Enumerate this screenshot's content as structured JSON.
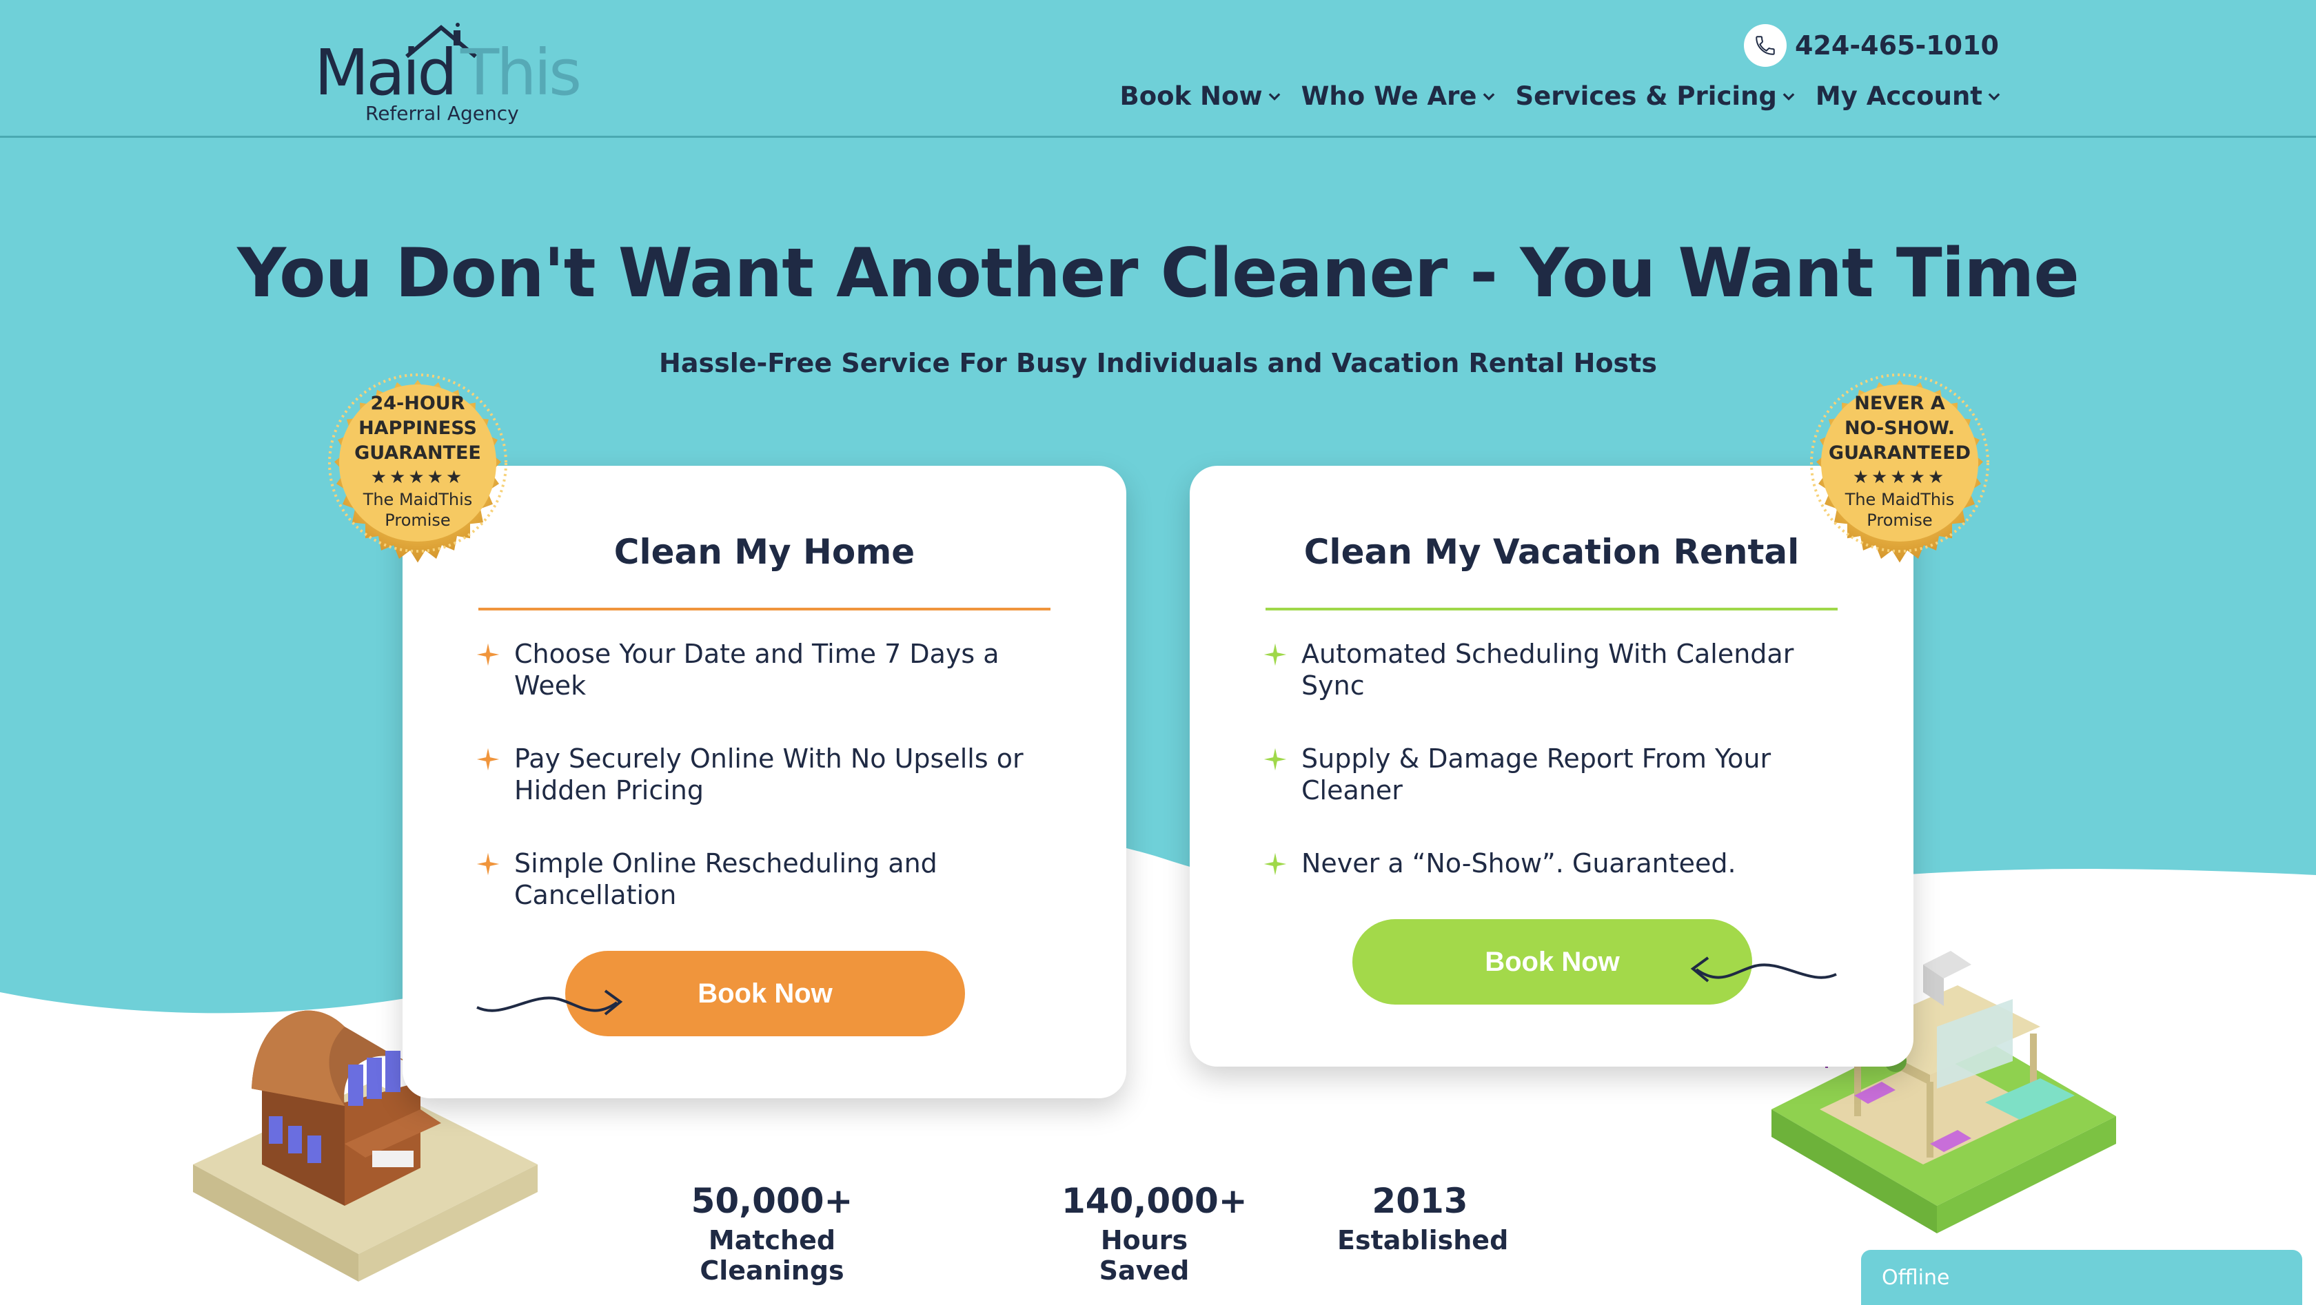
{
  "brand": {
    "logo_main": "Maid",
    "logo_accent": "This",
    "logo_sub": "Referral Agency"
  },
  "header": {
    "phone": "424-465-1010",
    "nav": [
      {
        "label": "Book Now",
        "icon": "chevron-down-icon"
      },
      {
        "label": "Who We Are",
        "icon": "chevron-down-icon"
      },
      {
        "label": "Services & Pricing",
        "icon": "chevron-down-icon"
      },
      {
        "label": "My Account",
        "icon": "chevron-down-icon"
      }
    ]
  },
  "hero": {
    "title": "You Don't Want Another Cleaner - You Want Time",
    "subtitle": "Hassle-Free Service For Busy Individuals and Vacation Rental Hosts"
  },
  "seals": {
    "left": {
      "line1": "24-HOUR",
      "line2": "HAPPINESS",
      "line3": "GUARANTEE",
      "stars": "★★★★★",
      "small1": "The MaidThis",
      "small2": "Promise"
    },
    "right": {
      "line1": "NEVER A",
      "line2": "NO-SHOW.",
      "line3": "GUARANTEED",
      "stars": "★★★★★",
      "small1": "The MaidThis",
      "small2": "Promise"
    }
  },
  "cards": {
    "home": {
      "title": "Clean My Home",
      "items": [
        "Choose Your Date and Time 7 Days a Week",
        "Pay Securely Online With No Upsells or Hidden Pricing",
        "Simple Online Rescheduling and Cancellation"
      ],
      "button": "Book Now"
    },
    "rental": {
      "title": "Clean My Vacation Rental",
      "items": [
        "Automated Scheduling With Calendar Sync",
        "Supply & Damage Report From Your Cleaner",
        "Never a “No-Show”. Guaranteed."
      ],
      "button": "Book Now"
    }
  },
  "stats": [
    {
      "value": "50,000+",
      "label": "Matched Cleanings"
    },
    {
      "value": "140,000+",
      "label": "Hours Saved"
    },
    {
      "value": "2013",
      "label": "Established"
    }
  ],
  "chat": {
    "status": "Offline"
  },
  "colors": {
    "teal": "#6fd0d8",
    "navy": "#1f2a44",
    "orange": "#f0953c",
    "green": "#a3d94a",
    "gold": "#eab546"
  }
}
